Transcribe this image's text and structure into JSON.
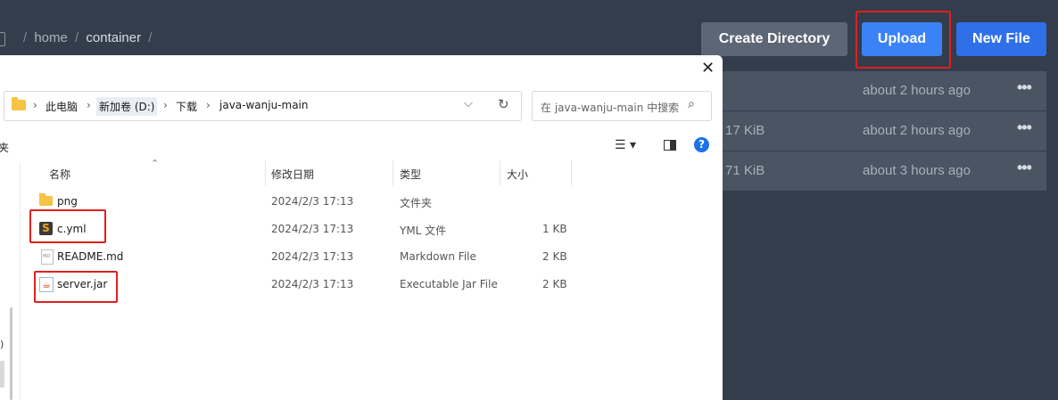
{
  "breadcrumb": {
    "sep1": "/",
    "seg1": "home",
    "sep2": "/",
    "seg2": "container",
    "sep3": "/"
  },
  "toolbar": {
    "create_directory": "Create Directory",
    "upload": "Upload",
    "new_file": "New File"
  },
  "bg_rows": [
    {
      "size": "",
      "time": "about 2 hours ago",
      "menu": "•••"
    },
    {
      "size": "17 KiB",
      "time": "about 2 hours ago",
      "menu": "•••"
    },
    {
      "size": "71 KiB",
      "time": "about 3 hours ago",
      "menu": "•••"
    }
  ],
  "dialog": {
    "close": "✕",
    "address": [
      "此电脑",
      "新加卷 (D:)",
      "下载",
      "java-wanju-main"
    ],
    "chevron": "›",
    "search_placeholder": "在 java-wanju-main 中搜索",
    "left_cut_label": "夹",
    "side_cut_label": ")",
    "columns": {
      "name": "名称",
      "date": "修改日期",
      "type": "类型",
      "size": "大小"
    },
    "files": [
      {
        "name": "png",
        "date": "2024/2/3 17:13",
        "type": "文件夹",
        "size": "",
        "icon": "folder-icon"
      },
      {
        "name": "c.yml",
        "date": "2024/2/3 17:13",
        "type": "YML 文件",
        "size": "1 KB",
        "icon": "sublime-file-icon"
      },
      {
        "name": "README.md",
        "date": "2024/2/3 17:13",
        "type": "Markdown File",
        "size": "2 KB",
        "icon": "markdown-file-icon"
      },
      {
        "name": "server.jar",
        "date": "2024/2/3 17:13",
        "type": "Executable Jar File",
        "size": "2 KB",
        "icon": "java-jar-icon"
      }
    ]
  },
  "colors": {
    "highlight_border": "#e02020",
    "upload": "#3b82f6",
    "new_file": "#2f6fe8",
    "create_dir": "#5c6674"
  }
}
